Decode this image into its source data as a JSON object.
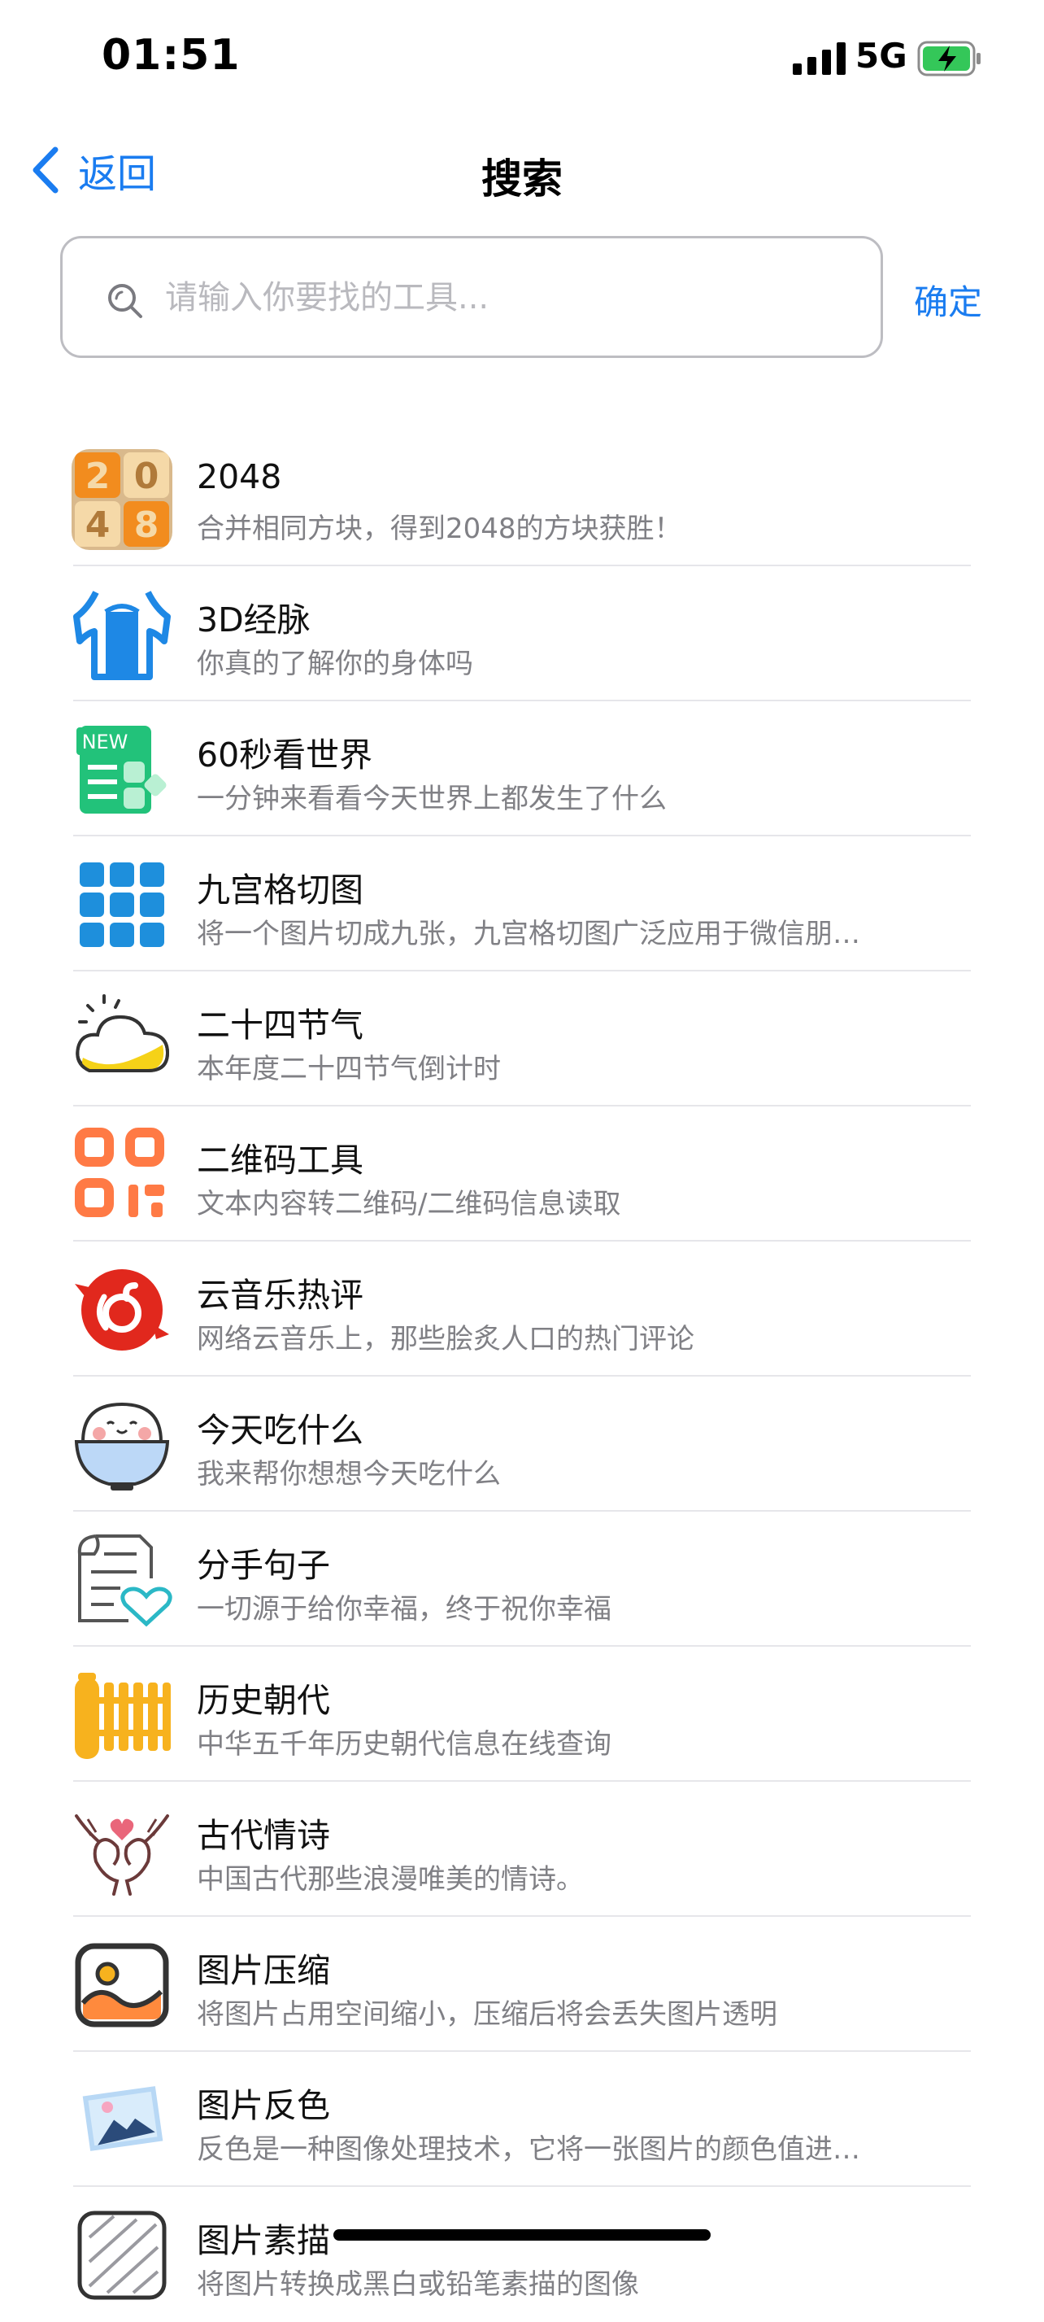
{
  "status_bar": {
    "time": "01:51",
    "network": "5G"
  },
  "nav": {
    "back_label": "返回",
    "title": "搜索"
  },
  "search": {
    "placeholder": "请输入你要找的工具...",
    "value": "",
    "confirm_label": "确定"
  },
  "tools": [
    {
      "title": "2048",
      "desc": "合并相同方块，得到2048的方块获胜！",
      "icon": "game-2048-icon"
    },
    {
      "title": "3D经脉",
      "desc": "你真的了解你的身体吗",
      "icon": "body-meridian-icon"
    },
    {
      "title": "60秒看世界",
      "desc": "一分钟来看看今天世界上都发生了什么",
      "icon": "news-icon",
      "badge": "NEW"
    },
    {
      "title": "九宫格切图",
      "desc": "将一个图片切成九张，九宫格切图广泛应用于微信朋…",
      "icon": "grid-cut-icon"
    },
    {
      "title": "二十四节气",
      "desc": "本年度二十四节气倒计时",
      "icon": "weather-cloud-icon"
    },
    {
      "title": "二维码工具",
      "desc": "文本内容转二维码/二维码信息读取",
      "icon": "qr-code-icon"
    },
    {
      "title": "云音乐热评",
      "desc": "网络云音乐上，那些脍炙人口的热门评论",
      "icon": "music-comment-icon"
    },
    {
      "title": "今天吃什么",
      "desc": "我来帮你想想今天吃什么",
      "icon": "rice-bowl-icon"
    },
    {
      "title": "分手句子",
      "desc": "一切源于给你幸福，终于祝你幸福",
      "icon": "document-heart-icon"
    },
    {
      "title": "历史朝代",
      "desc": "中华五千年历史朝代信息在线查询",
      "icon": "bamboo-scroll-icon"
    },
    {
      "title": "古代情诗",
      "desc": "中国古代那些浪漫唯美的情诗。",
      "icon": "birds-heart-icon"
    },
    {
      "title": "图片压缩",
      "desc": "将图片占用空间缩小，压缩后将会丢失图片透明",
      "icon": "image-compress-icon"
    },
    {
      "title": "图片反色",
      "desc": "反色是一种图像处理技术，它将一张图片的颜色值进…",
      "icon": "image-invert-icon"
    },
    {
      "title": "图片素描",
      "desc": "将图片转换成黑白或铅笔素描的图像",
      "icon": "image-sketch-icon"
    }
  ],
  "colors": {
    "accent": "#1a7cf0",
    "battery_fill": "#34c759"
  }
}
